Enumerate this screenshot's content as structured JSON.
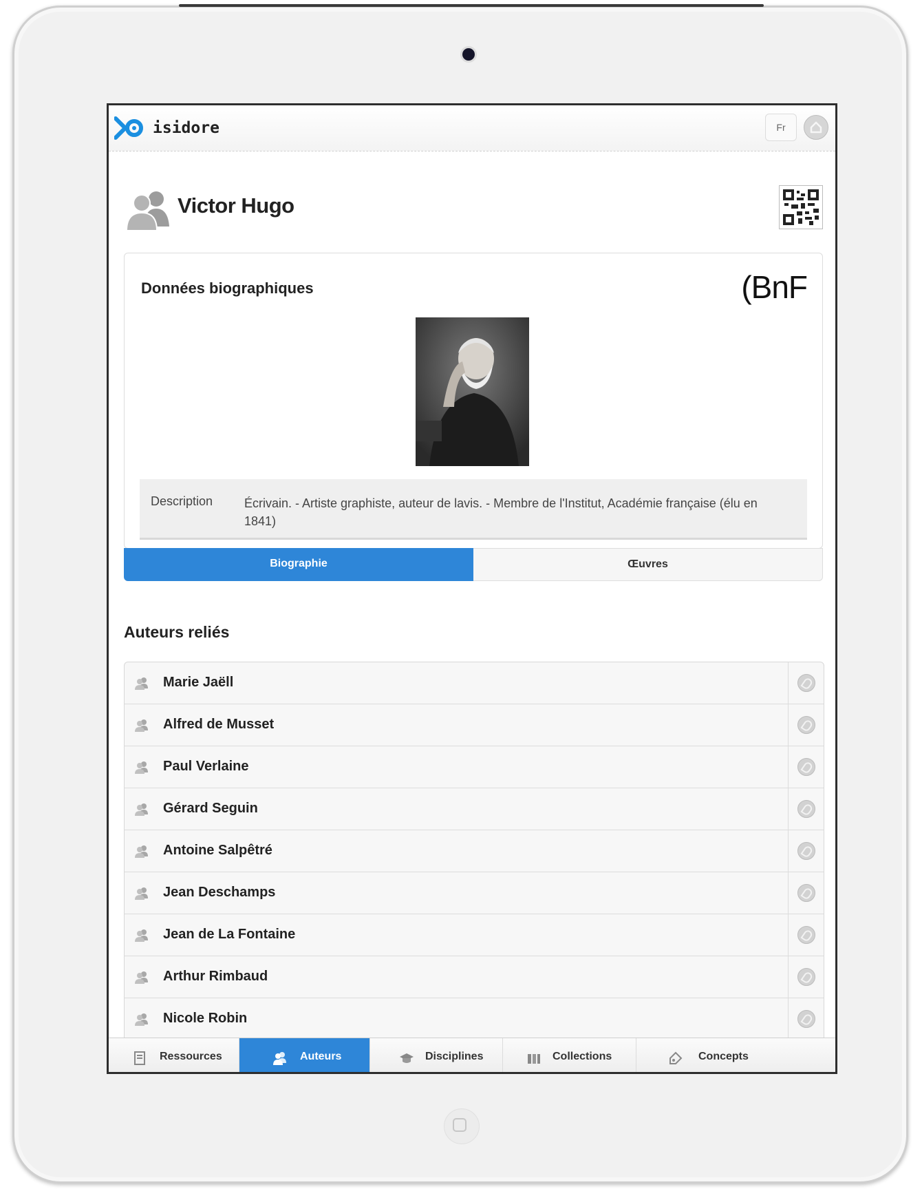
{
  "app": {
    "logo_text": "isidore",
    "language": "Fr"
  },
  "author": {
    "name": "Victor Hugo"
  },
  "bio_card": {
    "title": "Données biographiques",
    "source_logo": "(BnF",
    "description_label": "Description",
    "description_value": "Écrivain. - Artiste graphiste, auteur de lavis. - Membre de l'Institut, Académie française (élu en 1841)"
  },
  "tabs": [
    {
      "label": "Biographie",
      "active": true
    },
    {
      "label": "Œuvres",
      "active": false
    }
  ],
  "related": {
    "title": "Auteurs reliés",
    "items": [
      {
        "name": "Marie Jaëll"
      },
      {
        "name": "Alfred de Musset"
      },
      {
        "name": "Paul Verlaine"
      },
      {
        "name": "Gérard Seguin"
      },
      {
        "name": "Antoine Salpêtré"
      },
      {
        "name": "Jean Deschamps"
      },
      {
        "name": "Jean de La Fontaine"
      },
      {
        "name": "Arthur Rimbaud"
      },
      {
        "name": "Nicole Robin"
      }
    ]
  },
  "bottom_nav": [
    {
      "label": "Ressources",
      "icon": "document-icon",
      "active": false
    },
    {
      "label": "Auteurs",
      "icon": "people-icon",
      "active": true
    },
    {
      "label": "Disciplines",
      "icon": "graduation-cap-icon",
      "active": false
    },
    {
      "label": "Collections",
      "icon": "collection-icon",
      "active": false
    },
    {
      "label": "Concepts",
      "icon": "tag-icon",
      "active": false
    }
  ],
  "colors": {
    "accent": "#2e86d8",
    "logo_blue": "#1b8fe0"
  }
}
